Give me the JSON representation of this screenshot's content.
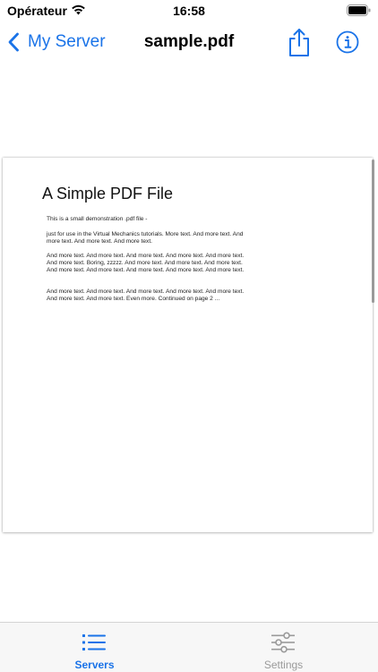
{
  "status_bar": {
    "carrier": "Opérateur",
    "time": "16:58"
  },
  "nav": {
    "back_label": "My Server",
    "title": "sample.pdf",
    "share_icon": "share-icon",
    "info_icon": "info-icon"
  },
  "pdf": {
    "heading": "A Simple PDF File",
    "paragraphs": [
      "This is a small demonstration .pdf file -",
      "just for use in the Virtual Mechanics tutorials. More text. And more text. And more text. And more text. And more text.",
      "And more text. And more text. And more text. And more text. And more text. And more text. Boring, zzzzz. And more text. And more text. And more text. And more text. And more text. And more text. And more text. And more text.",
      "And more text. And more text. And more text. And more text. And more text. And more text. And more text. Even more. Continued on page 2 ..."
    ]
  },
  "tabs": [
    {
      "label": "Servers",
      "icon": "list-icon",
      "active": true
    },
    {
      "label": "Settings",
      "icon": "sliders-icon",
      "active": false
    }
  ],
  "colors": {
    "accent": "#1a73e8",
    "inactive": "#9a9a9a",
    "tab_bar_bg": "#f7f7f7"
  }
}
